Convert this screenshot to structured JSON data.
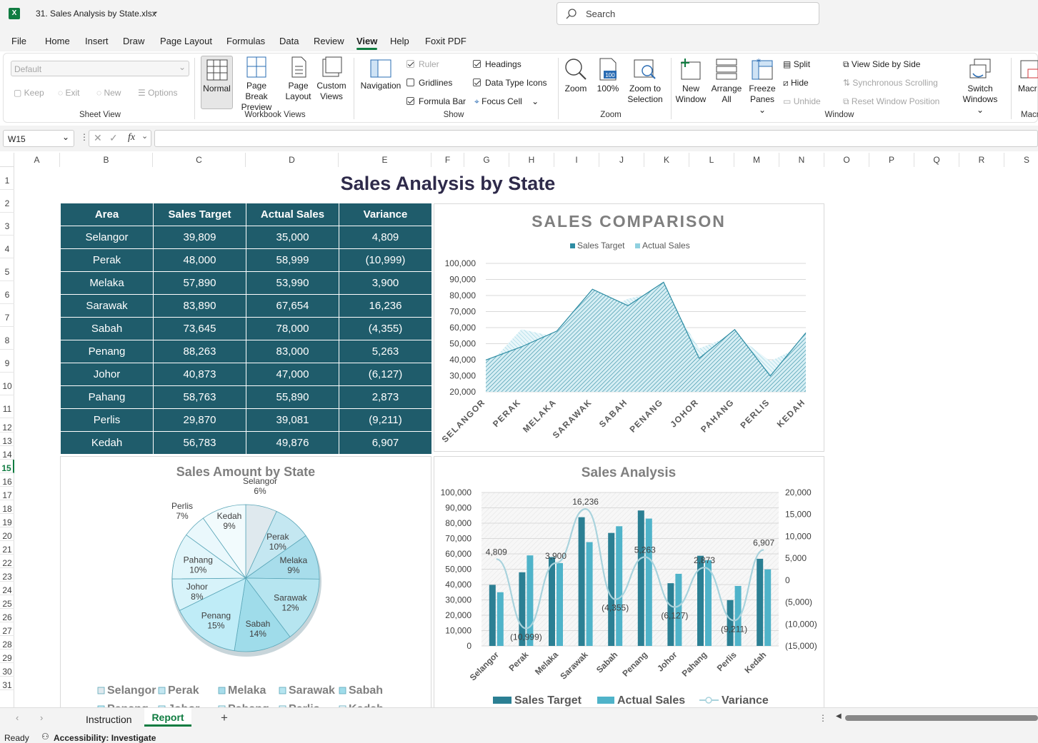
{
  "titlebar": {
    "filename": "31. Sales Analysis by State.xlsx",
    "search_placeholder": "Search"
  },
  "menu": [
    "File",
    "Home",
    "Insert",
    "Draw",
    "Page Layout",
    "Formulas",
    "Data",
    "Review",
    "View",
    "Help",
    "Foxit PDF"
  ],
  "active_menu": "View",
  "ribbon": {
    "sheet_view": {
      "dropdown_value": "Default",
      "keep": "Keep",
      "exit": "Exit",
      "new": "New",
      "options": "Options",
      "label": "Sheet View"
    },
    "workbook_views": {
      "normal": "Normal",
      "page_break_1": "Page Break",
      "page_break_2": "Preview",
      "page_layout_1": "Page",
      "page_layout_2": "Layout",
      "custom_1": "Custom",
      "custom_2": "Views",
      "label": "Workbook Views"
    },
    "show": {
      "navigation": "Navigation",
      "ruler": "Ruler",
      "gridlines": "Gridlines",
      "formula_bar": "Formula Bar",
      "headings": "Headings",
      "data_type_icons": "Data Type Icons",
      "focus_cell": "Focus Cell",
      "label": "Show"
    },
    "zoom": {
      "zoom": "Zoom",
      "hundred": "100%",
      "icon_hundred": "100",
      "zoom_sel_1": "Zoom to",
      "zoom_sel_2": "Selection",
      "label": "Zoom"
    },
    "window": {
      "new_1": "New",
      "new_2": "Window",
      "arrange_1": "Arrange",
      "arrange_2": "All",
      "freeze_1": "Freeze",
      "freeze_2": "Panes",
      "split": "Split",
      "hide": "Hide",
      "unhide": "Unhide",
      "side_by_side": "View Side by Side",
      "sync": "Synchronous Scrolling",
      "reset": "Reset Window Position",
      "switch_1": "Switch",
      "switch_2": "Windows",
      "label": "Window"
    },
    "macros": {
      "label_1": "Macr",
      "label_2": "Macr"
    }
  },
  "formula_bar": {
    "name_box": "W15",
    "formula": ""
  },
  "columns": [
    "A",
    "B",
    "C",
    "D",
    "E",
    "F",
    "G",
    "H",
    "I",
    "J",
    "K",
    "L",
    "M",
    "N",
    "O",
    "P",
    "Q",
    "R",
    "S"
  ],
  "rows": [
    "1",
    "2",
    "3",
    "4",
    "5",
    "6",
    "7",
    "8",
    "9",
    "10",
    "11",
    "12",
    "13",
    "14",
    "15",
    "16",
    "17",
    "18",
    "19",
    "20",
    "21",
    "22",
    "23",
    "24",
    "25",
    "26",
    "27",
    "28",
    "29",
    "30",
    "31"
  ],
  "report": {
    "title": "Sales Analysis by State",
    "headers": [
      "Area",
      "Sales Target",
      "Actual Sales",
      "Variance"
    ],
    "rows": [
      [
        "Selangor",
        "39,809",
        "35,000",
        "4,809"
      ],
      [
        "Perak",
        "48,000",
        "58,999",
        "(10,999)"
      ],
      [
        "Melaka",
        "57,890",
        "53,990",
        "3,900"
      ],
      [
        "Sarawak",
        "83,890",
        "67,654",
        "16,236"
      ],
      [
        "Sabah",
        "73,645",
        "78,000",
        "(4,355)"
      ],
      [
        "Penang",
        "88,263",
        "83,000",
        "5,263"
      ],
      [
        "Johor",
        "40,873",
        "47,000",
        "(6,127)"
      ],
      [
        "Pahang",
        "58,763",
        "55,890",
        "2,873"
      ],
      [
        "Perlis",
        "29,870",
        "39,081",
        "(9,211)"
      ],
      [
        "Kedah",
        "56,783",
        "49,876",
        "6,907"
      ]
    ]
  },
  "chart_data": [
    {
      "type": "area",
      "title": "SALES COMPARISON",
      "categories": [
        "SELANGOR",
        "PERAK",
        "MELAKA",
        "SARAWAK",
        "SABAH",
        "PENANG",
        "JOHOR",
        "PAHANG",
        "PERLIS",
        "KEDAH"
      ],
      "series": [
        {
          "name": "Sales Target",
          "values": [
            39809,
            48000,
            57890,
            83890,
            73645,
            88263,
            40873,
            58763,
            29870,
            56783
          ]
        },
        {
          "name": "Actual Sales",
          "values": [
            35000,
            58999,
            53990,
            67654,
            78000,
            83000,
            47000,
            55890,
            39081,
            49876
          ]
        }
      ],
      "yticks": [
        "100,000",
        "90,000",
        "80,000",
        "70,000",
        "60,000",
        "50,000",
        "40,000",
        "30,000",
        "20,000"
      ],
      "ylim": [
        20000,
        100000
      ],
      "legend": "top",
      "grid": true
    },
    {
      "type": "pie",
      "title": "Sales Amount by State",
      "labels": [
        "Selangor",
        "Perak",
        "Melaka",
        "Sarawak",
        "Sabah",
        "Penang",
        "Johor",
        "Pahang",
        "Perlis",
        "Kedah"
      ],
      "percents": [
        "6%",
        "10%",
        "9%",
        "12%",
        "14%",
        "15%",
        "8%",
        "10%",
        "7%",
        "9%"
      ],
      "values": [
        39809,
        48000,
        57890,
        83890,
        73645,
        88263,
        40873,
        58763,
        29870,
        56783
      ],
      "legend": "bottom"
    },
    {
      "type": "bar",
      "title": "Sales Analysis",
      "categories": [
        "Selangor",
        "Perak",
        "Melaka",
        "Sarawak",
        "Sabah",
        "Penang",
        "Johor",
        "Pahang",
        "Perlis",
        "Kedah"
      ],
      "series": [
        {
          "name": "Sales Target",
          "values": [
            39809,
            48000,
            57890,
            83890,
            73645,
            88263,
            40873,
            58763,
            29870,
            56783
          ]
        },
        {
          "name": "Actual Sales",
          "values": [
            35000,
            58999,
            53990,
            67654,
            78000,
            83000,
            47000,
            55890,
            39081,
            49876
          ]
        },
        {
          "name": "Variance",
          "values": [
            4809,
            -10999,
            3900,
            16236,
            -4355,
            5263,
            -6127,
            2873,
            -9211,
            6907
          ]
        }
      ],
      "variance_labels": [
        "4,809",
        "(10,999)",
        "3,900",
        "16,236",
        "(4,355)",
        "5,263",
        "(6,127)",
        "2,873",
        "(9,211)",
        "6,907"
      ],
      "yticks_left": [
        "100,000",
        "90,000",
        "80,000",
        "70,000",
        "60,000",
        "50,000",
        "40,000",
        "30,000",
        "20,000",
        "10,000",
        "0"
      ],
      "yticks_right": [
        "20,000",
        "15,000",
        "10,000",
        "5,000",
        "0",
        "(5,000)",
        "(10,000)",
        "(15,000)"
      ],
      "ylim_left": [
        0,
        100000
      ],
      "ylim_right": [
        -15000,
        20000
      ],
      "legend": "bottom"
    }
  ],
  "sheets": [
    "Instruction",
    "Report"
  ],
  "active_sheet": "Report",
  "status": {
    "ready": "Ready",
    "accessibility": "Accessibility: Investigate"
  },
  "colors": {
    "table": "#1f5c6b",
    "bar1": "#2b7f93",
    "bar2": "#4fb3c9",
    "area1": "#2e8ca3",
    "area2": "#8fd0df",
    "variance": "#a9d3dd"
  }
}
